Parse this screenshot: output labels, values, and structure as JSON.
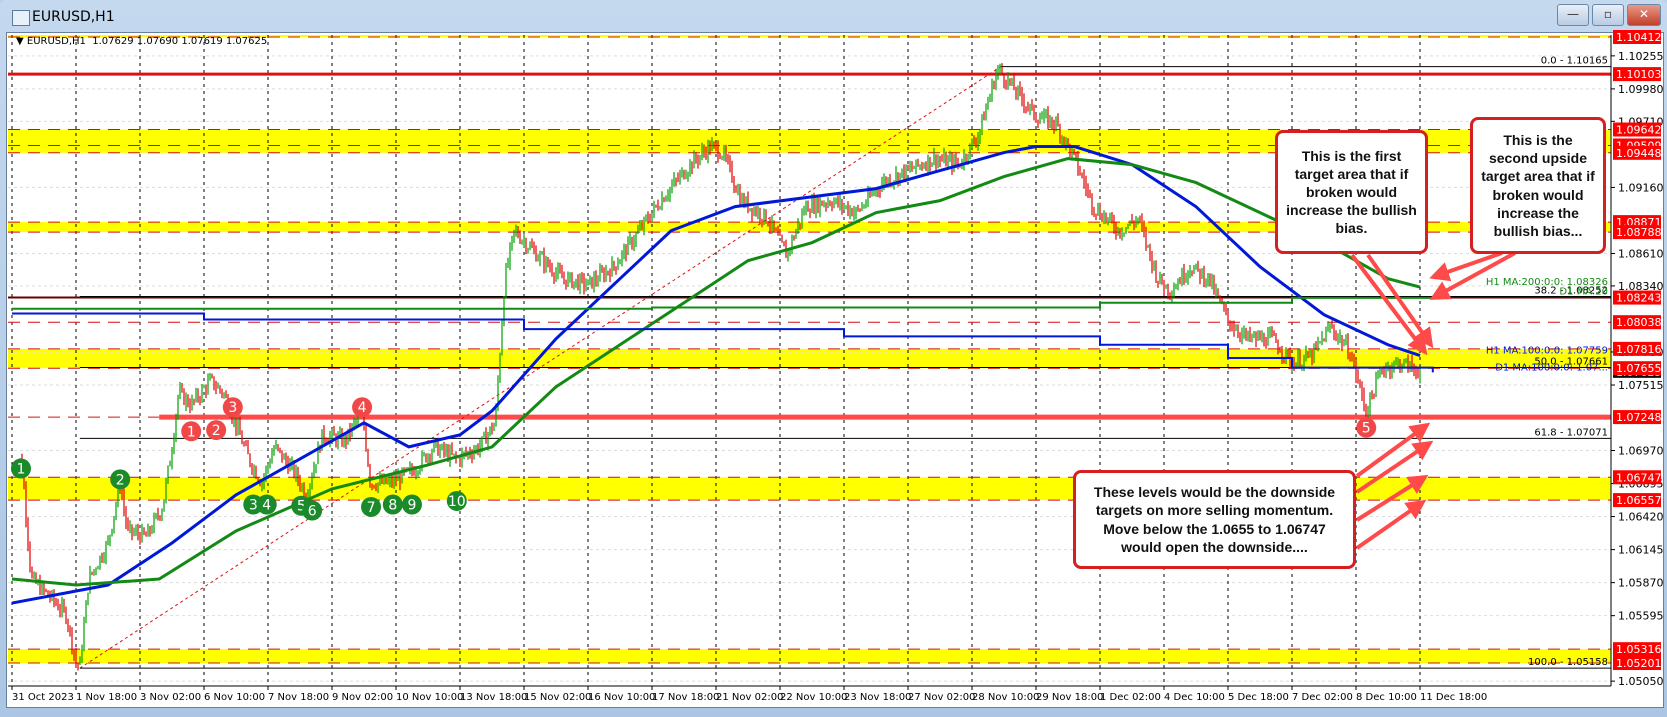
{
  "window": {
    "title": "EURUSD,H1",
    "buttons": {
      "minimize": "—",
      "maximize": "▫",
      "close": "✕"
    }
  },
  "chart_header": {
    "arrow": "▼",
    "symbol": "EURUSD,H1",
    "ohlc": "1.07629 1.07690 1.07619 1.07625"
  },
  "callouts": {
    "first_target": "This is the first target area that if broken would increase the bullish bias.",
    "second_target": "This is the second upside target area that if broken would increase the bullish bias...",
    "downside": "These levels would be the downside targets on more selling momentum. Move below the 1.0655 to 1.06747 would open the downside...."
  },
  "colors": {
    "up": "#00a000",
    "down": "#e00000",
    "ma_h1_100": "#0018d8",
    "ma_h1_200": "#138a13",
    "level": "#ff4a4a",
    "zone": "#ffff00",
    "label_bg": "#ff0000"
  },
  "chart_data": {
    "type": "candlestick",
    "symbol": "EURUSD",
    "timeframe": "H1",
    "x_ticks": [
      "31 Oct 2023",
      "1 Nov 18:00",
      "3 Nov 02:00",
      "6 Nov 10:00",
      "7 Nov 18:00",
      "9 Nov 02:00",
      "10 Nov 10:00",
      "13 Nov 18:00",
      "15 Nov 02:00",
      "16 Nov 10:00",
      "17 Nov 18:00",
      "21 Nov 02:00",
      "22 Nov 10:00",
      "23 Nov 18:00",
      "27 Nov 02:00",
      "28 Nov 10:00",
      "29 Nov 18:00",
      "1 Dec 02:00",
      "4 Dec 10:00",
      "5 Dec 18:00",
      "7 Dec 02:00",
      "8 Dec 10:00",
      "11 Dec 18:00"
    ],
    "y_ticks": [
      "1.10255",
      "1.09980",
      "1.09710",
      "1.09160",
      "1.08610",
      "1.08340",
      "1.07790",
      "1.07515",
      "1.06970",
      "1.06695",
      "1.06420",
      "1.06145",
      "1.05870",
      "1.05595",
      "1.05050"
    ],
    "ylim": [
      1.05,
      1.1046
    ],
    "price_path": [
      [
        0,
        1.068
      ],
      [
        0.15,
        1.069
      ],
      [
        0.3,
        1.059
      ],
      [
        0.6,
        1.0575
      ],
      [
        0.85,
        1.056
      ],
      [
        1.0,
        1.052
      ],
      [
        1.06,
        1.0518
      ],
      [
        1.2,
        1.059
      ],
      [
        1.5,
        1.062
      ],
      [
        1.69,
        1.067
      ],
      [
        1.8,
        1.063
      ],
      [
        2.1,
        1.0625
      ],
      [
        2.35,
        1.065
      ],
      [
        2.5,
        1.07
      ],
      [
        2.6,
        1.0745
      ],
      [
        2.8,
        1.0735
      ],
      [
        3.1,
        1.0755
      ],
      [
        3.3,
        1.0745
      ],
      [
        3.45,
        1.0725
      ],
      [
        3.7,
        1.069
      ],
      [
        3.9,
        1.067
      ],
      [
        4.1,
        1.07
      ],
      [
        4.4,
        1.068
      ],
      [
        4.6,
        1.066
      ],
      [
        4.85,
        1.071
      ],
      [
        5.2,
        1.0705
      ],
      [
        5.47,
        1.073
      ],
      [
        5.6,
        1.067
      ],
      [
        5.9,
        1.067
      ],
      [
        6.25,
        1.068
      ],
      [
        6.6,
        1.07
      ],
      [
        6.95,
        1.069
      ],
      [
        7.3,
        1.07
      ],
      [
        7.55,
        1.072
      ],
      [
        7.7,
        1.084
      ],
      [
        7.85,
        1.088
      ],
      [
        8.2,
        1.086
      ],
      [
        8.6,
        1.084
      ],
      [
        9.0,
        1.0835
      ],
      [
        9.4,
        1.085
      ],
      [
        9.8,
        1.088
      ],
      [
        10.2,
        1.091
      ],
      [
        10.6,
        1.0935
      ],
      [
        10.9,
        1.095
      ],
      [
        11.1,
        1.0945
      ],
      [
        11.4,
        1.0905
      ],
      [
        11.8,
        1.089
      ],
      [
        12.1,
        1.086
      ],
      [
        12.4,
        1.09
      ],
      [
        12.8,
        1.0905
      ],
      [
        13.2,
        1.0895
      ],
      [
        13.6,
        1.092
      ],
      [
        14.0,
        1.093
      ],
      [
        14.4,
        1.094
      ],
      [
        14.8,
        1.0935
      ],
      [
        15.1,
        1.096
      ],
      [
        15.4,
        1.1015
      ],
      [
        15.7,
        1.0995
      ],
      [
        16.0,
        1.0975
      ],
      [
        16.3,
        1.097
      ],
      [
        16.6,
        1.094
      ],
      [
        16.9,
        1.09
      ],
      [
        17.3,
        1.088
      ],
      [
        17.6,
        1.089
      ],
      [
        17.9,
        1.084
      ],
      [
        18.1,
        1.083
      ],
      [
        18.4,
        1.085
      ],
      [
        18.7,
        1.084
      ],
      [
        19.0,
        1.0805
      ],
      [
        19.3,
        1.079
      ],
      [
        19.7,
        1.079
      ],
      [
        20.0,
        1.077
      ],
      [
        20.3,
        1.0775
      ],
      [
        20.6,
        1.08
      ],
      [
        20.9,
        1.078
      ],
      [
        21.16,
        1.073
      ],
      [
        21.4,
        1.0765
      ],
      [
        21.7,
        1.077
      ],
      [
        22.0,
        1.0763
      ]
    ],
    "moving_averages": [
      {
        "name": "H1 MA:100:0:0",
        "label": "H1 MA:100:0:0: 1.07759",
        "color": "#0018d8",
        "points": [
          [
            0,
            1.057
          ],
          [
            1.5,
            1.0585
          ],
          [
            2.5,
            1.062
          ],
          [
            3.5,
            1.066
          ],
          [
            4.5,
            1.069
          ],
          [
            5.5,
            1.072
          ],
          [
            6.2,
            1.07
          ],
          [
            7,
            1.071
          ],
          [
            7.5,
            1.073
          ],
          [
            8.5,
            1.079
          ],
          [
            9.5,
            1.084
          ],
          [
            10.3,
            1.088
          ],
          [
            11.3,
            1.09
          ],
          [
            13.5,
            1.0915
          ],
          [
            14.5,
            1.093
          ],
          [
            15.5,
            1.0945
          ],
          [
            16.0,
            1.095
          ],
          [
            16.6,
            1.095
          ],
          [
            17.5,
            1.0935
          ],
          [
            18.5,
            1.09
          ],
          [
            19.5,
            1.085
          ],
          [
            20.5,
            1.081
          ],
          [
            21.5,
            1.0785
          ],
          [
            22,
            1.0776
          ]
        ]
      },
      {
        "name": "H1 MA:200:0:0",
        "label": "H1 MA:200:0:0: 1.08326",
        "color": "#138a13",
        "points": [
          [
            0,
            1.059
          ],
          [
            1,
            1.0585
          ],
          [
            2.3,
            1.059
          ],
          [
            3.5,
            1.063
          ],
          [
            5,
            1.0665
          ],
          [
            6.5,
            1.0685
          ],
          [
            7.5,
            1.07
          ],
          [
            8.5,
            1.075
          ],
          [
            9.5,
            1.0785
          ],
          [
            10.5,
            1.082
          ],
          [
            11.5,
            1.0855
          ],
          [
            12.5,
            1.087
          ],
          [
            13.5,
            1.0895
          ],
          [
            14.5,
            1.0905
          ],
          [
            15.5,
            1.0925
          ],
          [
            16.5,
            1.094
          ],
          [
            17.5,
            1.0935
          ],
          [
            18.5,
            1.092
          ],
          [
            19.5,
            1.0895
          ],
          [
            20.5,
            1.087
          ],
          [
            21.5,
            1.084
          ],
          [
            22,
            1.0833
          ]
        ]
      },
      {
        "name": "D1 MA:200",
        "label": "D1 MA:20",
        "color": "#138a13",
        "step": true,
        "points": [
          [
            0,
            1.0815
          ],
          [
            10,
            1.0816
          ],
          [
            17,
            1.082
          ],
          [
            20,
            1.0824
          ],
          [
            22.2,
            1.0825
          ]
        ]
      },
      {
        "name": "D1 MA:100",
        "label": "D1 MA:100:0:0: 1.07...",
        "color": "#0018d8",
        "step": true,
        "points": [
          [
            0,
            1.0811
          ],
          [
            3,
            1.0806
          ],
          [
            8,
            1.0798
          ],
          [
            13,
            1.0792
          ],
          [
            17,
            1.0785
          ],
          [
            19,
            1.0774
          ],
          [
            20,
            1.0766
          ],
          [
            22.2,
            1.0762
          ]
        ]
      }
    ],
    "price_levels": [
      "1.10412",
      "1.10103",
      "1.09642",
      "1.09509",
      "1.09448",
      "1.08871",
      "1.08788",
      "1.08243",
      "1.08038",
      "1.07816",
      "1.07655",
      "1.07248",
      "1.06747",
      "1.06557",
      "1.05316",
      "1.05201"
    ],
    "current_price": "1.07625",
    "zones": [
      [
        1.10412,
        1.1046
      ],
      [
        1.09448,
        1.09642
      ],
      [
        1.08788,
        1.08871
      ],
      [
        1.07655,
        1.07816
      ],
      [
        1.06557,
        1.06747
      ],
      [
        1.05201,
        1.05316
      ]
    ],
    "fibonacci": {
      "from": [
        1.06,
        1.05158
      ],
      "to": [
        15.45,
        1.10165
      ],
      "levels": [
        {
          "label": "0.0 - 1.10165",
          "price": 1.10165
        },
        {
          "label": "38.2 - 1.08252",
          "price": 1.08252
        },
        {
          "label": "50.0 - 1.07661",
          "price": 1.07661
        },
        {
          "label": "61.8 - 1.07071",
          "price": 1.07071
        },
        {
          "label": "100.0 - 1.05158",
          "price": 1.05158
        }
      ]
    },
    "markers": [
      {
        "label": "1",
        "color": "green",
        "x": 0.14,
        "price": 1.0682
      },
      {
        "label": "2",
        "color": "green",
        "x": 1.69,
        "price": 1.0673
      },
      {
        "label": "1",
        "color": "red",
        "x": 2.8,
        "price": 1.0713
      },
      {
        "label": "2",
        "color": "red",
        "x": 3.19,
        "price": 1.0714
      },
      {
        "label": "3",
        "color": "red",
        "x": 3.45,
        "price": 1.0733
      },
      {
        "label": "3",
        "color": "green",
        "x": 3.77,
        "price": 1.0652
      },
      {
        "label": "4",
        "color": "green",
        "x": 3.98,
        "price": 1.0652
      },
      {
        "label": "5",
        "color": "green",
        "x": 4.52,
        "price": 1.0651
      },
      {
        "label": "6",
        "color": "green",
        "x": 4.69,
        "price": 1.0647
      },
      {
        "label": "4",
        "color": "red",
        "x": 5.47,
        "price": 1.0733
      },
      {
        "label": "7",
        "color": "green",
        "x": 5.61,
        "price": 1.065
      },
      {
        "label": "8",
        "color": "green",
        "x": 5.95,
        "price": 1.0652
      },
      {
        "label": "9",
        "color": "green",
        "x": 6.25,
        "price": 1.0652
      },
      {
        "label": "10",
        "color": "green",
        "x": 6.95,
        "price": 1.0655
      },
      {
        "label": "5",
        "color": "red",
        "x": 21.16,
        "price": 1.0716
      }
    ]
  }
}
